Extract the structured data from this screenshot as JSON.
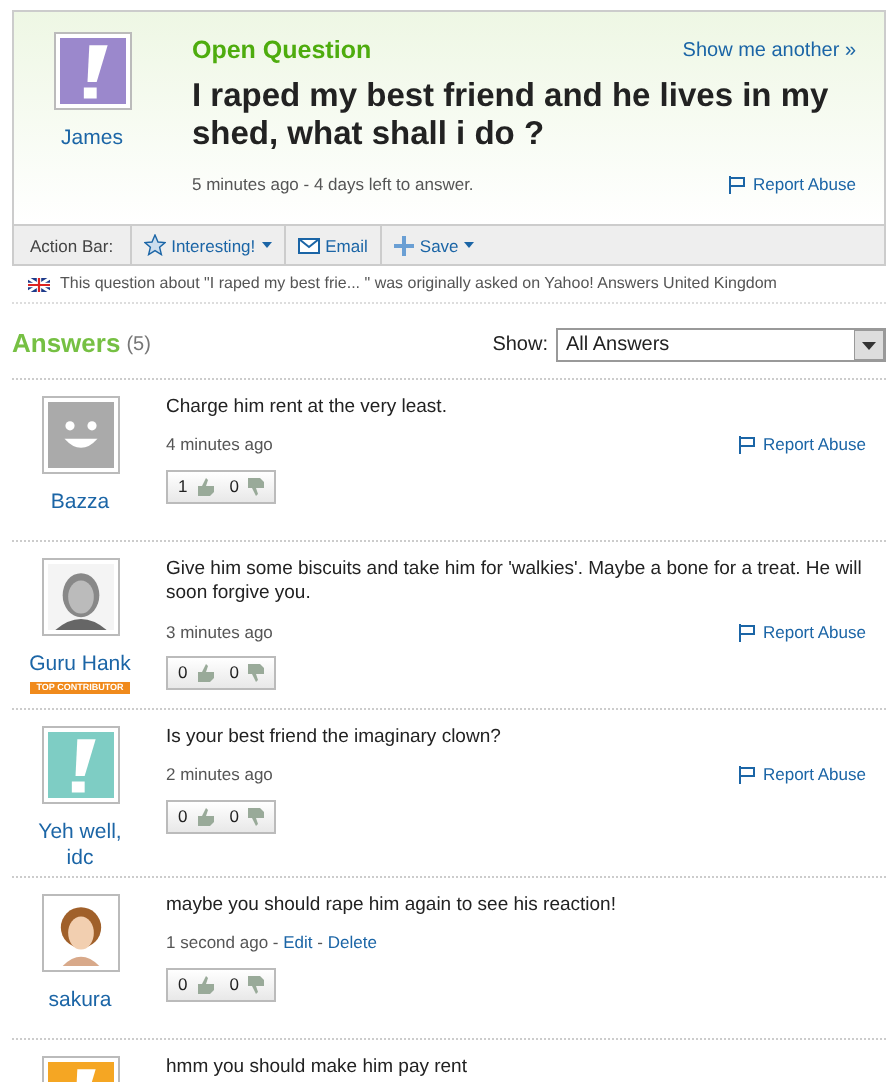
{
  "question": {
    "label": "Open Question",
    "show_another": "Show me another »",
    "asker": {
      "name": "James",
      "avatar": {
        "kind": "exclamation",
        "color": "#9b88cc"
      }
    },
    "title": "I raped my best friend and he lives in my shed, what shall i do ?",
    "meta": "5 minutes ago - 4 days left to answer.",
    "report": "Report Abuse"
  },
  "action_bar": {
    "label": "Action Bar:",
    "buttons": [
      {
        "kind": "interesting",
        "label": "Interesting!",
        "dropdown": true
      },
      {
        "kind": "email",
        "label": "Email",
        "dropdown": false
      },
      {
        "kind": "save",
        "label": "Save",
        "dropdown": true
      }
    ]
  },
  "origin_note": "This question about \"I raped my best frie... \" was originally asked on Yahoo! Answers United Kingdom",
  "answers_header": {
    "title": "Answers",
    "count": "(5)",
    "show_label": "Show:",
    "show_value": "All Answers"
  },
  "answers": [
    {
      "user": "Bazza",
      "avatar": {
        "kind": "smiley"
      },
      "text": "Charge him rent at the very least.",
      "time": "4 minutes ago",
      "report": "Report Abuse",
      "up": "1",
      "down": "0"
    },
    {
      "user": "Guru Hank",
      "badge": "TOP CONTRIBUTOR",
      "avatar": {
        "kind": "portrait"
      },
      "text": "Give him some biscuits and take him for 'walkies'. Maybe a bone for a treat. He will soon forgive you.",
      "time": "3 minutes ago",
      "report": "Report Abuse",
      "up": "0",
      "down": "0"
    },
    {
      "user": "Yeh well, idc",
      "avatar": {
        "kind": "exclamation",
        "color": "#7ecdc4"
      },
      "text": "Is your best friend the imaginary clown?",
      "time": "2 minutes ago",
      "report": "Report Abuse",
      "up": "0",
      "down": "0"
    },
    {
      "user": "sakura",
      "avatar": {
        "kind": "cartoon"
      },
      "text": "maybe you should rape him again to see his reaction!",
      "time": "1 second ago",
      "links": [
        {
          "sep": "-",
          "label": "Edit"
        },
        {
          "sep": "-",
          "label": "Delete"
        }
      ],
      "up": "0",
      "down": "0"
    },
    {
      "avatar": {
        "kind": "exclamation",
        "color": "#f5a623"
      },
      "text": "hmm you should make him pay rent"
    }
  ]
}
